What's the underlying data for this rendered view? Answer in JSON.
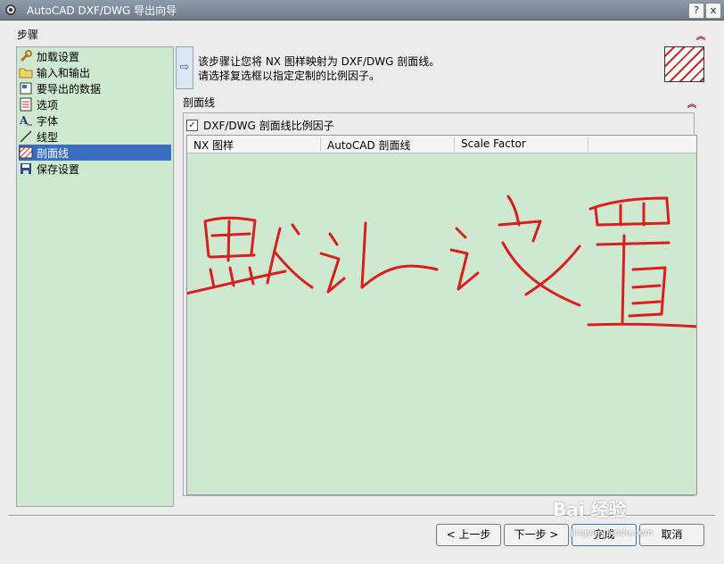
{
  "window": {
    "title": "AutoCAD DXF/DWG 导出向导",
    "help_glyph": "?",
    "close_glyph": "x"
  },
  "steps_section": {
    "label": "步骤",
    "items": [
      {
        "label": "加载设置",
        "icon": "wrench-icon"
      },
      {
        "label": "输入和输出",
        "icon": "folder-icon"
      },
      {
        "label": "要导出的数据",
        "icon": "data-icon"
      },
      {
        "label": "选项",
        "icon": "checklist-icon"
      },
      {
        "label": "字体",
        "icon": "font-icon"
      },
      {
        "label": "线型",
        "icon": "line-icon"
      },
      {
        "label": "剖面线",
        "icon": "hatch-icon"
      },
      {
        "label": "保存设置",
        "icon": "save-icon"
      }
    ],
    "selected_index": 6
  },
  "info": {
    "arrow_glyph": "⇨",
    "line1": "该步骤让您将 NX 图样映射为 DXF/DWG 剖面线。",
    "line2": "请选择复选框以指定定制的比例因子。"
  },
  "hatch_section": {
    "label": "剖面线",
    "checkbox_label": "DXF/DWG 剖面线比例因子",
    "checkbox_checked": true,
    "columns": [
      "NX 图样",
      "AutoCAD 剖面线",
      "Scale Factor"
    ],
    "handwriting": "默认设置"
  },
  "buttons": {
    "back": "< 上一步",
    "next": "下一步 >",
    "finish": "完成",
    "cancel": "取消"
  },
  "watermark": {
    "main": "Bai 经验",
    "sub": "jingyan.baidu.com"
  },
  "colors": {
    "accent": "#3a6fbf",
    "panel_green": "#cfe8d0",
    "handwriting_red": "#d81e1e"
  }
}
